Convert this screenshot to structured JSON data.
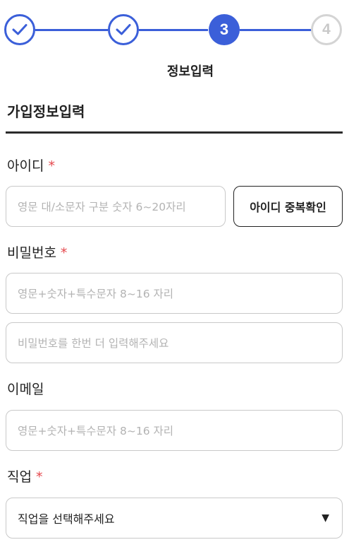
{
  "stepper": {
    "steps": [
      {
        "state": "done",
        "icon": "check-icon"
      },
      {
        "state": "done",
        "icon": "check-icon"
      },
      {
        "state": "current",
        "number": "3"
      },
      {
        "state": "pending",
        "number": "4"
      }
    ],
    "current_label": "정보입력",
    "accent_color": "#3b5fd9",
    "pending_color": "#d4d4d4"
  },
  "section": {
    "title": "가입정보입력"
  },
  "fields": {
    "id": {
      "label": "아이디",
      "required_mark": "*",
      "placeholder": "영문 대/소문자 구분 숫자 6~20자리",
      "check_button": "아이디 중복확인"
    },
    "password": {
      "label": "비밀번호",
      "required_mark": "*",
      "placeholder": "영문+숫자+특수문자 8~16 자리",
      "confirm_placeholder": "비밀번호를 한번 더 입력해주세요"
    },
    "email": {
      "label": "이메일",
      "placeholder": "영문+숫자+특수문자 8~16 자리"
    },
    "job": {
      "label": "직업",
      "required_mark": "*",
      "selected": "직업을 선택해주세요",
      "caret_icon": "caret-down-icon"
    }
  },
  "colors": {
    "required": "#e5484d"
  }
}
